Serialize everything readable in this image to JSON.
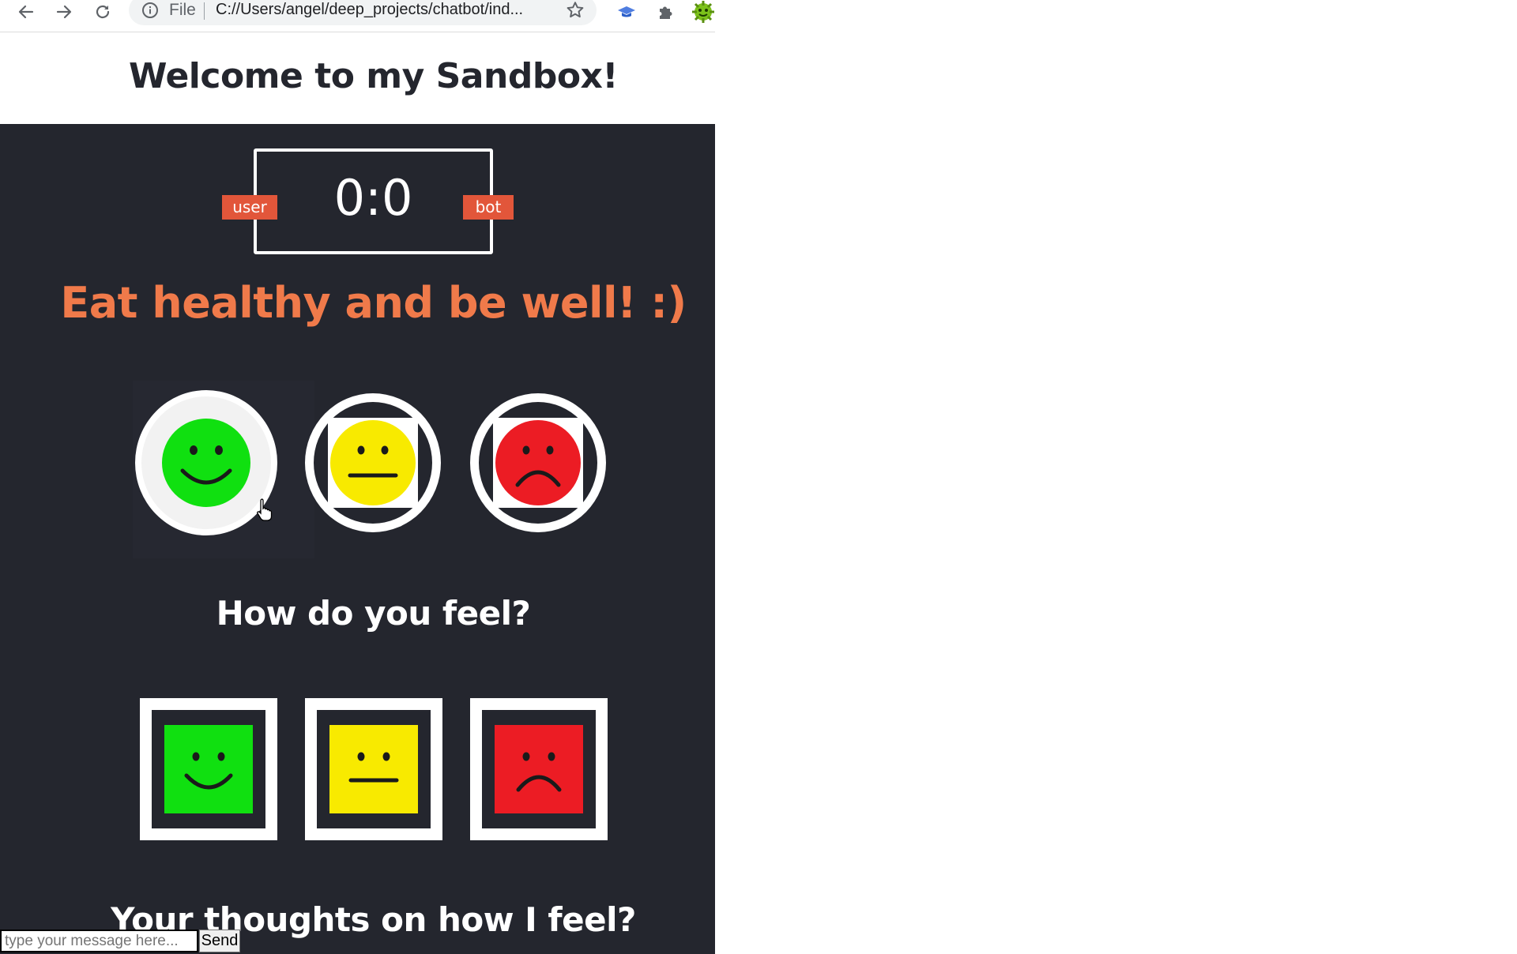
{
  "browser": {
    "scheme_label": "File",
    "url": "C://Users/angel/deep_projects/chatbot/ind..."
  },
  "header": {
    "title": "Welcome to my Sandbox!"
  },
  "scoreboard": {
    "score": "0:0",
    "user_tag": "user",
    "bot_tag": "bot"
  },
  "tagline": "Eat healthy and be well! :)",
  "feelings": {
    "question": "How do you feel?",
    "options": [
      {
        "mood": "happy",
        "color": "#10e010"
      },
      {
        "mood": "neutral",
        "color": "#f8ea00"
      },
      {
        "mood": "sad",
        "color": "#ec1c24"
      }
    ]
  },
  "bot_feelings": {
    "question": "Your thoughts on how I feel?",
    "options": [
      {
        "mood": "happy",
        "color": "#10e010"
      },
      {
        "mood": "neutral",
        "color": "#f8ea00"
      },
      {
        "mood": "sad",
        "color": "#ec1c24"
      }
    ]
  },
  "chat": {
    "placeholder": "type your message here...",
    "send_label": "Send"
  },
  "colors": {
    "background": "#24262e",
    "accent": "#e2563a",
    "tagline": "#f07a4a"
  }
}
